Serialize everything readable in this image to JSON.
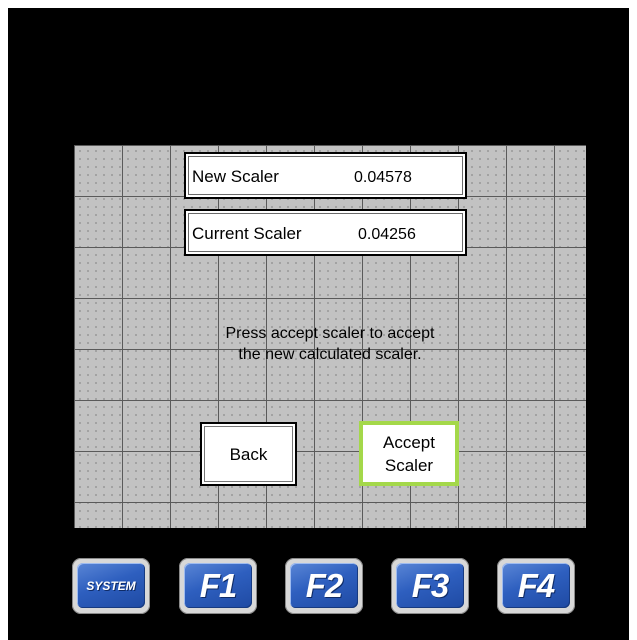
{
  "panel": {
    "new_scaler": {
      "label": "New Scaler",
      "value": "0.04578"
    },
    "current_scaler": {
      "label": "Current Scaler",
      "value": "0.04256"
    },
    "message": {
      "line1": "Press accept scaler to accept",
      "line2": "the new calculated scaler."
    },
    "back_button": "Back",
    "accept_button": {
      "line1": "Accept",
      "line2": "Scaler"
    }
  },
  "function_keys": [
    "SYSTEM",
    "F1",
    "F2",
    "F3",
    "F4"
  ],
  "colors": {
    "bezel": "#000000",
    "screen_background": "#c2c2c2",
    "accept_border": "#a4d84a",
    "key_blue": "#2e5fbf"
  }
}
